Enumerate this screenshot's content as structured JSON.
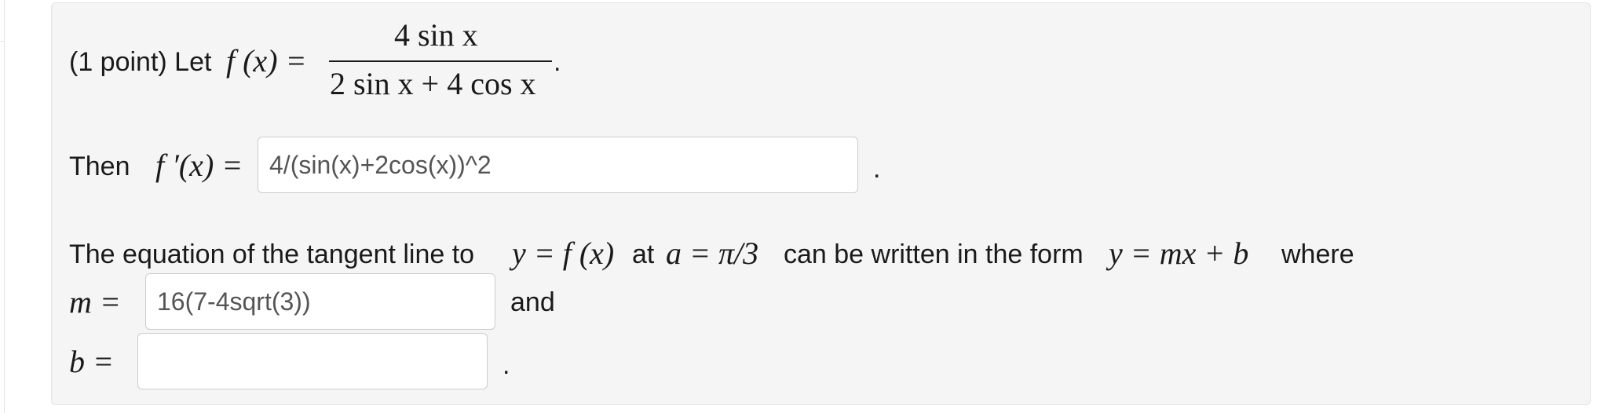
{
  "problem": {
    "prefix": "(1 point) Let",
    "definition": {
      "lhs": "f (x) =",
      "numerator": "4 sin x",
      "denominator": "2 sin x + 4 cos x",
      "end": "."
    },
    "derivative": {
      "prefix": "Then",
      "lhs": "f ′(x) =",
      "answer_value": "4/(sin(x)+2cos(x))^2",
      "end": "."
    },
    "tangent": {
      "text1": "The equation of the tangent line to",
      "math1": "y = f (x)",
      "text2": "at",
      "math2": "a = π/3",
      "text3": "can be written in the form",
      "math3": "y = mx + b",
      "text4": "where",
      "m_label": "m =",
      "m_value": "16(7-4sqrt(3))",
      "and_text": "and",
      "b_label": "b =",
      "b_value": "",
      "end": "."
    }
  }
}
